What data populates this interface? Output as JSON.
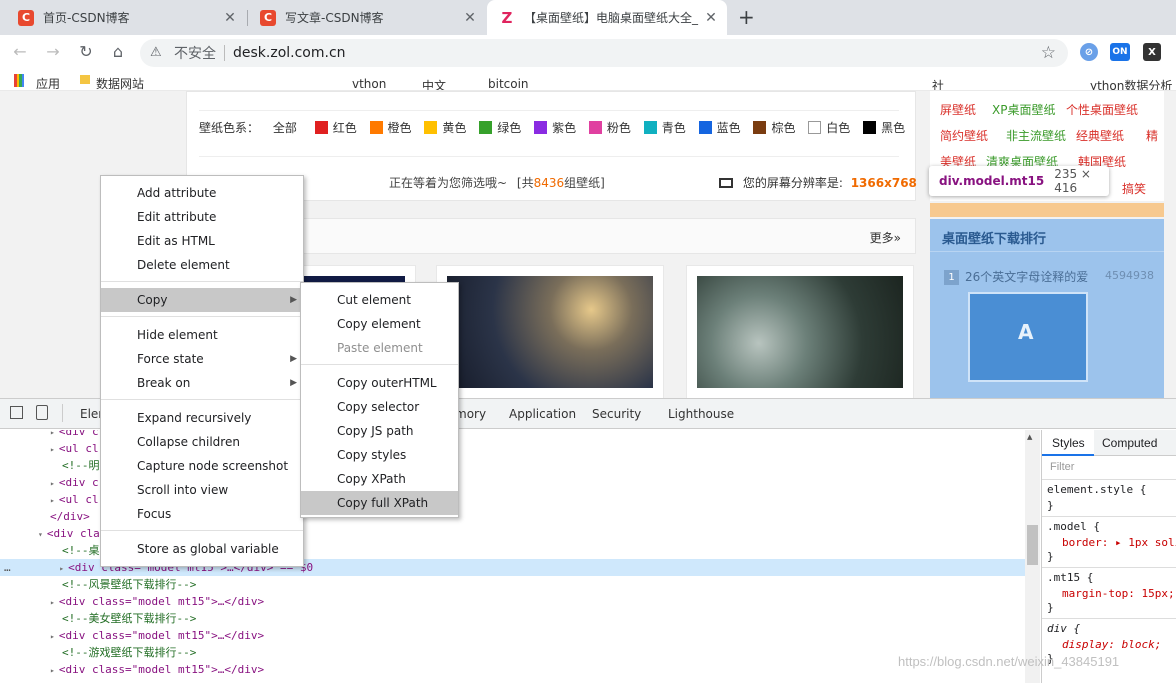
{
  "browser": {
    "tabs": [
      {
        "title": "首页-CSDN博客",
        "icon": "csdn-icon"
      },
      {
        "title": "写文章-CSDN博客",
        "icon": "csdn-icon"
      },
      {
        "title": "【桌面壁纸】电脑桌面壁纸大全_",
        "icon": "zol-icon"
      }
    ],
    "new_tab": "+",
    "security_label": "不安全",
    "url": "desk.zol.com.cn",
    "extensions": [
      "ON"
    ],
    "bookmarks": [
      "应用",
      "数据网站",
      "vthon",
      "中文",
      "bitcoin",
      "社",
      "ython数据分析"
    ]
  },
  "page": {
    "color_filter_label": "壁纸色系：",
    "color_all": "全部",
    "colors": [
      {
        "name": "红色",
        "hex": "#e02020"
      },
      {
        "name": "橙色",
        "hex": "#ff7a00"
      },
      {
        "name": "黄色",
        "hex": "#ffc000"
      },
      {
        "name": "绿色",
        "hex": "#36a12b"
      },
      {
        "name": "紫色",
        "hex": "#8a2be2"
      },
      {
        "name": "粉色",
        "hex": "#e040a0"
      },
      {
        "name": "青色",
        "hex": "#10b0c0"
      },
      {
        "name": "蓝色",
        "hex": "#1565e0"
      },
      {
        "name": "棕色",
        "hex": "#7a3c10"
      },
      {
        "name": "白色",
        "hex": "#ffffff"
      },
      {
        "name": "黑色",
        "hex": "#000000"
      }
    ],
    "status_text": "正在等着为您筛选哦~",
    "count_prefix": "[共",
    "count": "8436",
    "count_suffix": "组壁纸]",
    "resolution_label": "您的屏幕分辨率是:",
    "resolution": "1366x768",
    "more_link": "更多»",
    "right_tags": [
      {
        "row": [
          "屏壁纸",
          "XP桌面壁纸",
          "个性桌面壁纸"
        ]
      },
      {
        "row": [
          "简约壁纸",
          "非主流壁纸",
          "经典壁纸",
          "精"
        ]
      },
      {
        "row": [
          "美壁纸",
          "清爽桌面壁纸",
          "韩国壁纸"
        ]
      },
      {
        "row": [
          "搞笑"
        ]
      }
    ],
    "ranking_title": "桌面壁纸下载排行",
    "ranking_item": {
      "rank": "1",
      "title": "26个英文字母诠释的爱",
      "count": "4594938"
    }
  },
  "tooltip": {
    "selector": "div.model.mt15",
    "size": "235 × 416"
  },
  "devtools": {
    "tabs": [
      "Elem",
      "mory",
      "Application",
      "Security",
      "Lighthouse"
    ],
    "elements": [
      {
        "indent": 1,
        "tri": "▸",
        "text": "<div cl"
      },
      {
        "indent": 1,
        "tri": "▸",
        "text": "<ul cl"
      },
      {
        "indent": 1,
        "tri": "",
        "text": "<!--明"
      },
      {
        "indent": 1,
        "tri": "▸",
        "text": "<div c"
      },
      {
        "indent": 1,
        "tri": "▸",
        "text": "<ul cl"
      },
      {
        "indent": 1,
        "tri": "",
        "text": "</div>"
      },
      {
        "indent": 0,
        "tri": "▾",
        "text": "<div cla"
      },
      {
        "indent": 1,
        "tri": "",
        "text": "<!--桌"
      },
      {
        "indent": 1,
        "tri": "▸",
        "text": "<div class=\"model mt15\">…</div> == $0"
      },
      {
        "indent": 1,
        "tri": "",
        "text": "<!--风景壁纸下载排行-->"
      },
      {
        "indent": 1,
        "tri": "▸",
        "text": "<div class=\"model mt15\">…</div>"
      },
      {
        "indent": 1,
        "tri": "",
        "text": "<!--美女壁纸下载排行-->"
      },
      {
        "indent": 1,
        "tri": "▸",
        "text": "<div class=\"model mt15\">…</div>"
      },
      {
        "indent": 1,
        "tri": "",
        "text": "<!--游戏壁纸下载排行-->"
      },
      {
        "indent": 1,
        "tri": "▸",
        "text": "<div class=\"model mt15\">…</div>"
      }
    ],
    "styles_tabs": [
      "Styles",
      "Computed"
    ],
    "filter_placeholder": "Filter",
    "rules": [
      {
        "selector": "element.style {",
        "prop": "",
        "close": "}"
      },
      {
        "selector": ".model {",
        "prop": "border: ▸ 1px soli",
        "close": "}"
      },
      {
        "selector": ".mt15 {",
        "prop": "margin-top: 15px;",
        "close": "}"
      },
      {
        "selector": "div {",
        "prop": "display: block;",
        "close": "}"
      }
    ]
  },
  "context_menu": {
    "items": [
      "Add attribute",
      "Edit attribute",
      "Edit as HTML",
      "Delete element",
      "Copy",
      "Hide element",
      "Force state",
      "Break on",
      "Expand recursively",
      "Collapse children",
      "Capture node screenshot",
      "Scroll into view",
      "Focus",
      "Store as global variable"
    ],
    "highlighted": "Copy"
  },
  "copy_submenu": {
    "items": [
      "Cut element",
      "Copy element",
      "Paste element",
      "Copy outerHTML",
      "Copy selector",
      "Copy JS path",
      "Copy styles",
      "Copy XPath",
      "Copy full XPath"
    ],
    "disabled": "Paste element",
    "highlighted": "Copy full XPath"
  },
  "watermark": "https://blog.csdn.net/weixin_43845191"
}
